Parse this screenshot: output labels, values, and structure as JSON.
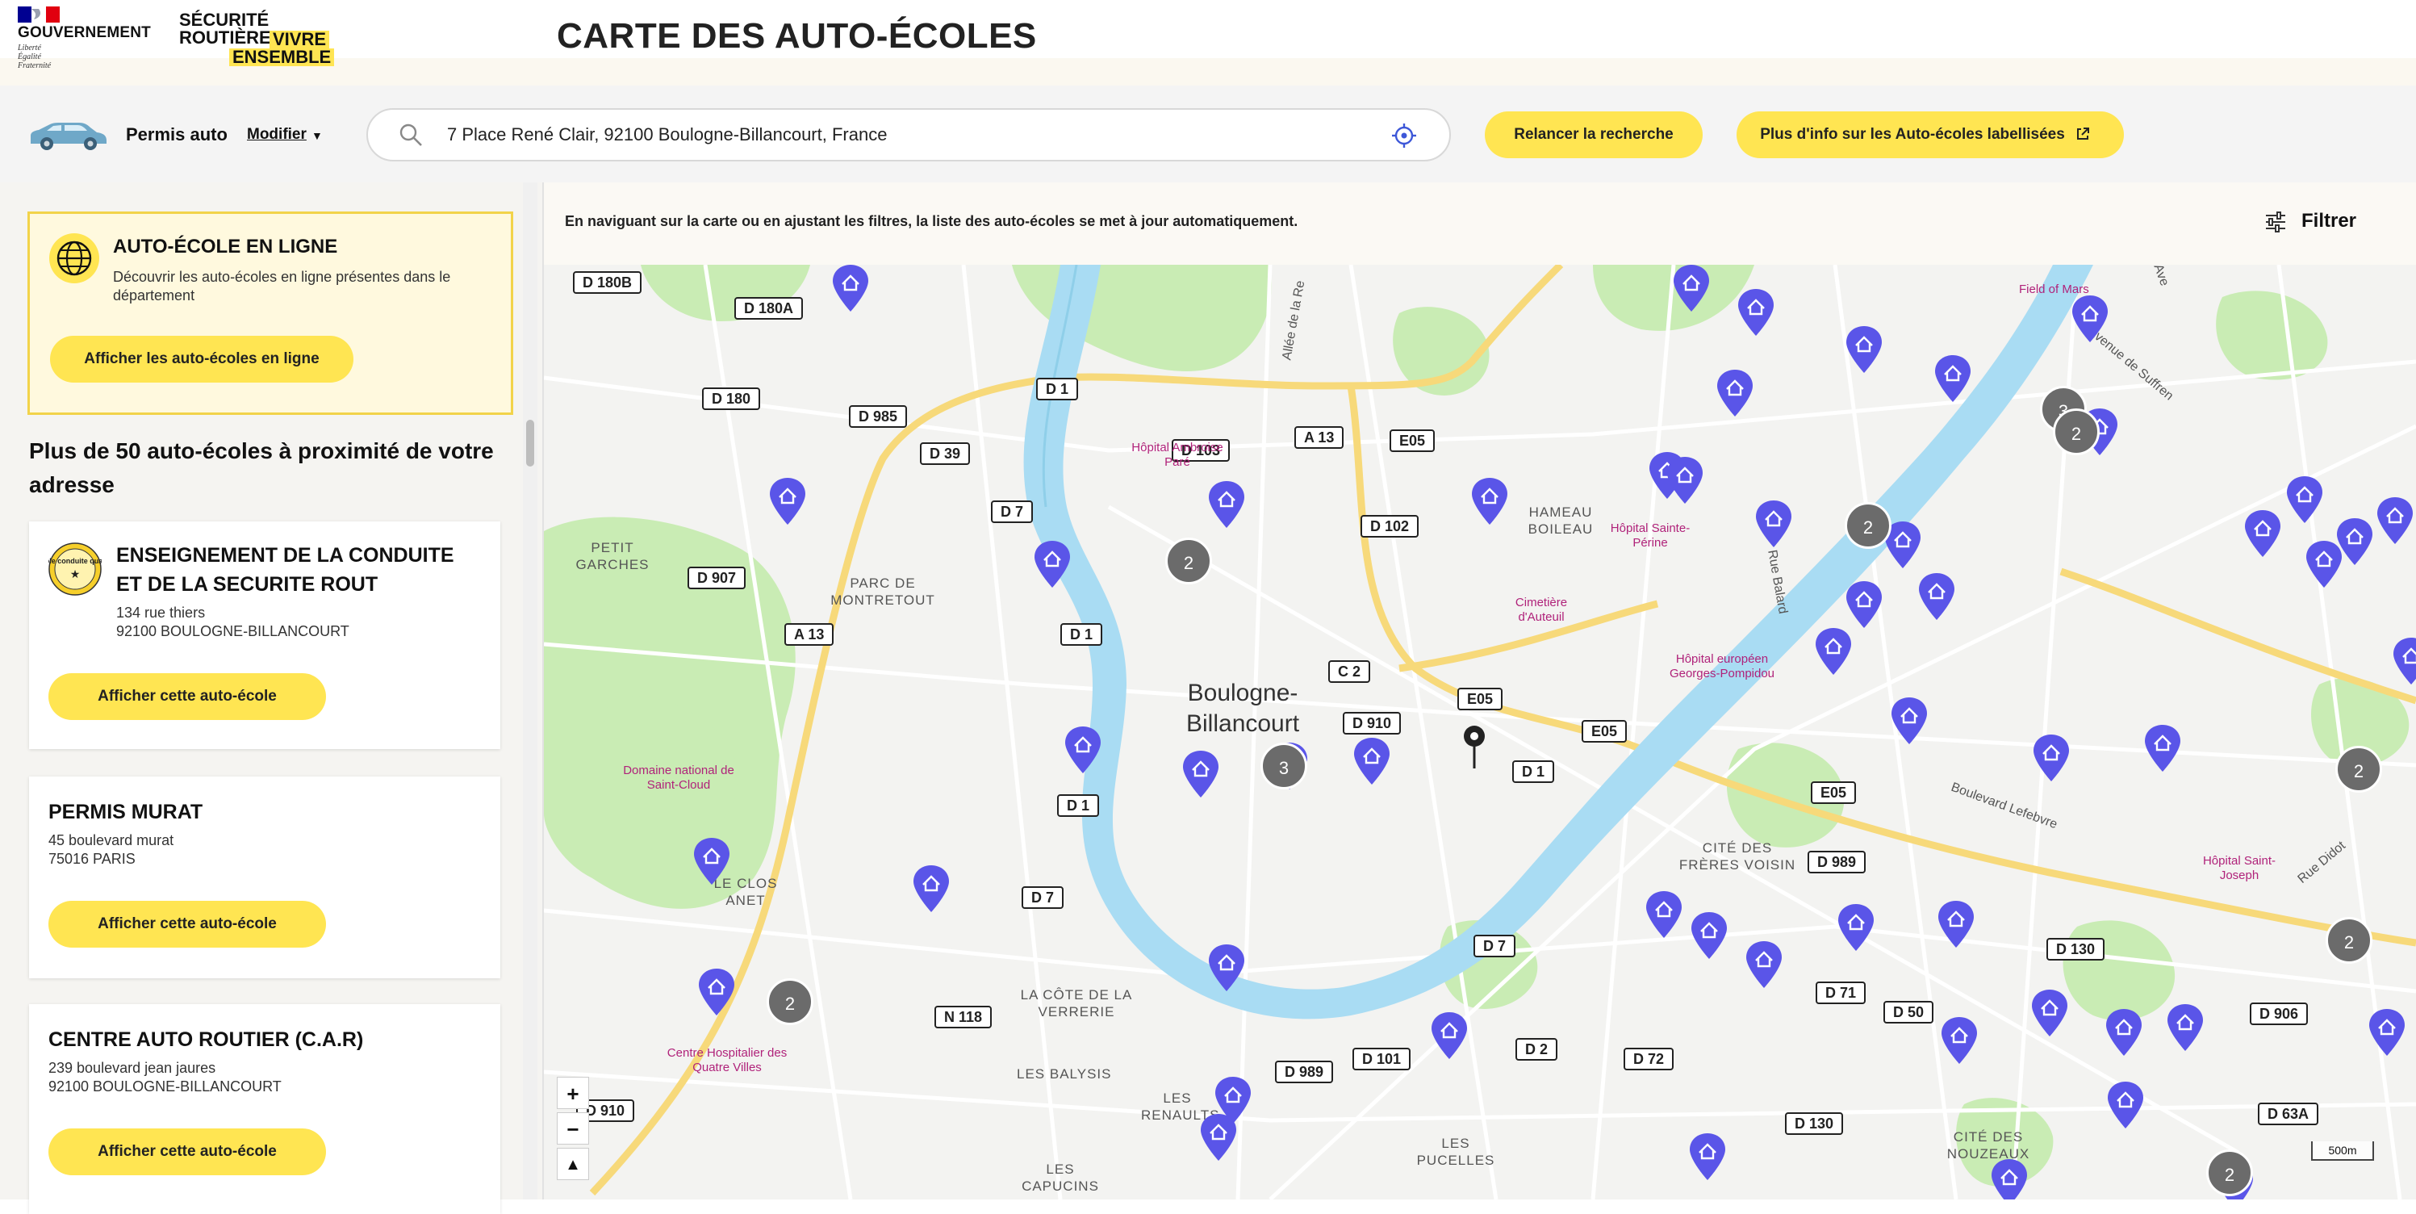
{
  "header": {
    "gouv_text": "GOUVERNEMENT",
    "motto": [
      "Liberté",
      "Égalité",
      "Fraternité"
    ],
    "sr_line1": "SÉCURITÉ",
    "sr_line2": "ROUTIÈRE",
    "sr_highlight_1": "VIVRE",
    "sr_highlight_2": "ENSEMBLE",
    "page_title": "CARTE DES AUTO-ÉCOLES"
  },
  "searchbar": {
    "car_icon": "car-icon",
    "permis_label": "Permis auto",
    "modifier_label": "Modifier",
    "address_value": "7 Place René Clair, 92100 Boulogne-Billancourt, France",
    "relaunch_label": "Relancer la recherche",
    "info_label": "Plus d'info sur les Auto-écoles labellisées"
  },
  "sidebar": {
    "online": {
      "title": "AUTO-ÉCOLE EN LIGNE",
      "description": "Découvrir les auto-écoles en ligne présentes dans le département",
      "button": "Afficher les auto-écoles en ligne"
    },
    "results_heading": "Plus de 50 auto-écoles à proximité de votre adresse",
    "badge_text": "école conduite qualité",
    "cards": [
      {
        "name": "ENSEIGNEMENT DE LA CONDUITE ET DE LA SECURITE ROUT",
        "address1": "134 rue thiers",
        "address2": "92100 BOULOGNE-BILLANCOURT",
        "button": "Afficher cette auto-école"
      },
      {
        "name": "PERMIS MURAT",
        "address1": "45 boulevard murat",
        "address2": "75016 PARIS",
        "button": "Afficher cette auto-école"
      },
      {
        "name": "CENTRE AUTO ROUTIER (C.A.R)",
        "address1": "239 boulevard jean jaures",
        "address2": "92100 BOULOGNE-BILLANCOURT",
        "button": "Afficher cette auto-école"
      }
    ]
  },
  "map": {
    "info_text": "En naviguant sur la carte ou en ajustant les filtres, la liste des auto-écoles se met à jour automatiquement.",
    "filter_label": "Filtrer",
    "zoom_in": "+",
    "zoom_out": "−",
    "compass": "▲",
    "scale": "500m",
    "colors": {
      "water": "#a9dcf3",
      "park": "#c9ecb4",
      "road_major": "#f7d97a",
      "marker": "#5a55e8",
      "cluster": "#6b6b6b"
    },
    "road_labels": [
      "D 180B",
      "D 180A",
      "D 180",
      "D 985",
      "D 39",
      "D 1",
      "D 7",
      "D 907",
      "A 13",
      "D 103",
      "A 13",
      "E05",
      "D 102",
      "C 2",
      "D 910",
      "E05",
      "E05",
      "D 1",
      "D 1",
      "D 1",
      "D 7",
      "N 118",
      "D 989",
      "D 101",
      "D 2",
      "D 72",
      "D 7",
      "E05",
      "D 989",
      "D 130",
      "D 71",
      "D 50",
      "D 906",
      "D 130",
      "D 63A",
      "D 910"
    ],
    "area_labels": [
      "PETIT GARCHES",
      "PARC DE MONTRETOUT",
      "HAMEAU BOILEAU",
      "LE CLOS ANET",
      "CITÉ DES FRÈRES VOISIN",
      "LA CÔTE DE LA VERRERIE",
      "LES BALYSIS",
      "LES RENAULTS",
      "LES PUCELLES",
      "LES CAPUCINS",
      "CITÉ DES NOUZEAUX"
    ],
    "poi_labels": [
      "Hôpital Ambroise Paré",
      "Cimetière d'Auteuil",
      "Hôpital Sainte-Périne",
      "Hôpital européen Georges-Pompidou",
      "Domaine national de Saint-Cloud",
      "Centre Hospitalier des Quatre Villes",
      "Hôpital Saint-Joseph",
      "Field of Mars"
    ],
    "street_labels": [
      "Allée de la Re",
      "Avenue de Suffren",
      "Rue Balard",
      "Boulevard Lefebvre",
      "Rue Didot",
      "Ave"
    ],
    "city_label_1": "Boulogne-",
    "city_label_2": "Billancourt",
    "clusters": [
      "2",
      "2",
      "3",
      "3",
      "2",
      "2",
      "2",
      "2",
      "2"
    ]
  }
}
